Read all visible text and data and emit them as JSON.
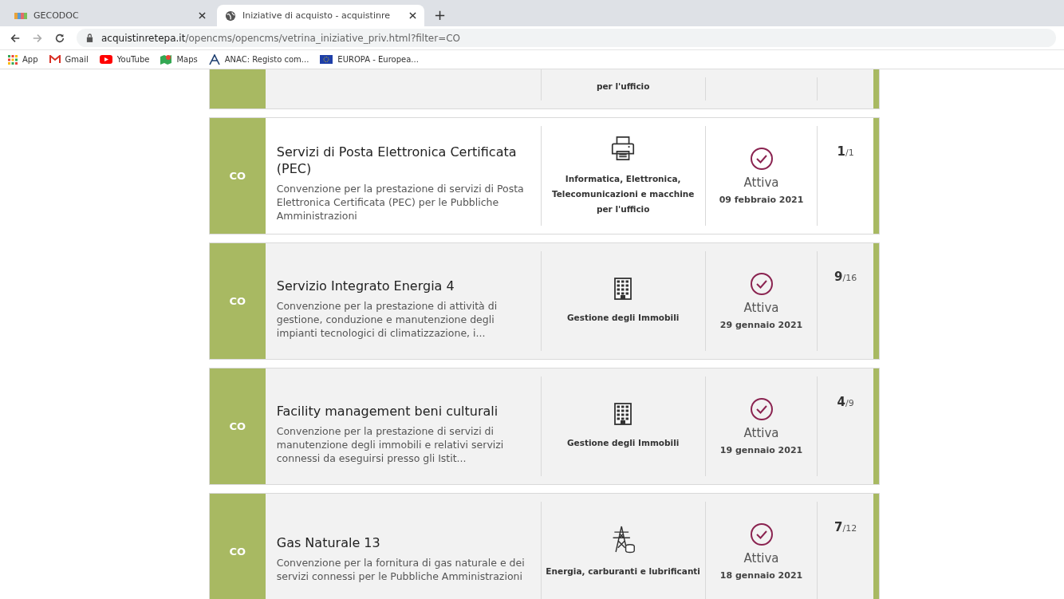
{
  "browser": {
    "tabs": [
      {
        "title": "GECODOC",
        "selected": false
      },
      {
        "title": "Iniziative di acquisto - acquistinre",
        "selected": true
      }
    ],
    "new_tab": "+",
    "url_host": "acquistinretepa.it",
    "url_path": "/opencms/opencms/vetrina_iniziative_priv.html?filter=CO",
    "bookmarks": [
      {
        "label": "App"
      },
      {
        "label": "Gmail"
      },
      {
        "label": "YouTube"
      },
      {
        "label": "Maps"
      },
      {
        "label": "ANAC: Registo com..."
      },
      {
        "label": "EUROPA - Europea..."
      }
    ]
  },
  "partial_card": {
    "category": "per l'ufficio"
  },
  "initiatives": [
    {
      "type": "CO",
      "title": "Servizi di Posta Elettronica Certificata (PEC)",
      "description": "Convenzione per la prestazione di servizi di Posta Elettronica Certificata (PEC) per le Pubbliche Amministrazioni",
      "category": "Informatica, Elettronica, Telecomunicazioni e macchine per l'ufficio",
      "kind": "printer",
      "status": "Attiva",
      "date": "09 febbraio 2021",
      "lots_active": "1",
      "lots_total": "/1",
      "highlighted": true
    },
    {
      "type": "CO",
      "title": "Servizio Integrato Energia 4",
      "description": "Convenzione per la prestazione di attività di gestione, conduzione e manutenzione degli impianti tecnologici di climatizzazione, i...",
      "category": "Gestione degli Immobili",
      "kind": "building",
      "status": "Attiva",
      "date": "29 gennaio 2021",
      "lots_active": "9",
      "lots_total": "/16",
      "highlighted": false
    },
    {
      "type": "CO",
      "title": "Facility management beni culturali",
      "description": "Convenzione per la prestazione di servizi di manutenzione degli immobili e relativi servizi connessi da eseguirsi presso gli Istit...",
      "category": "Gestione degli Immobili",
      "kind": "building",
      "status": "Attiva",
      "date": "19 gennaio 2021",
      "lots_active": "4",
      "lots_total": "/9",
      "highlighted": false
    },
    {
      "type": "CO",
      "title": "Gas Naturale 13",
      "description": "Convenzione per la fornitura di gas naturale e dei servizi connessi per le Pubbliche Amministrazioni",
      "category": "Energia, carburanti e lubrificanti",
      "kind": "energy",
      "status": "Attiva",
      "date": "18 gennaio 2021",
      "lots_active": "7",
      "lots_total": "/12",
      "highlighted": false
    }
  ]
}
